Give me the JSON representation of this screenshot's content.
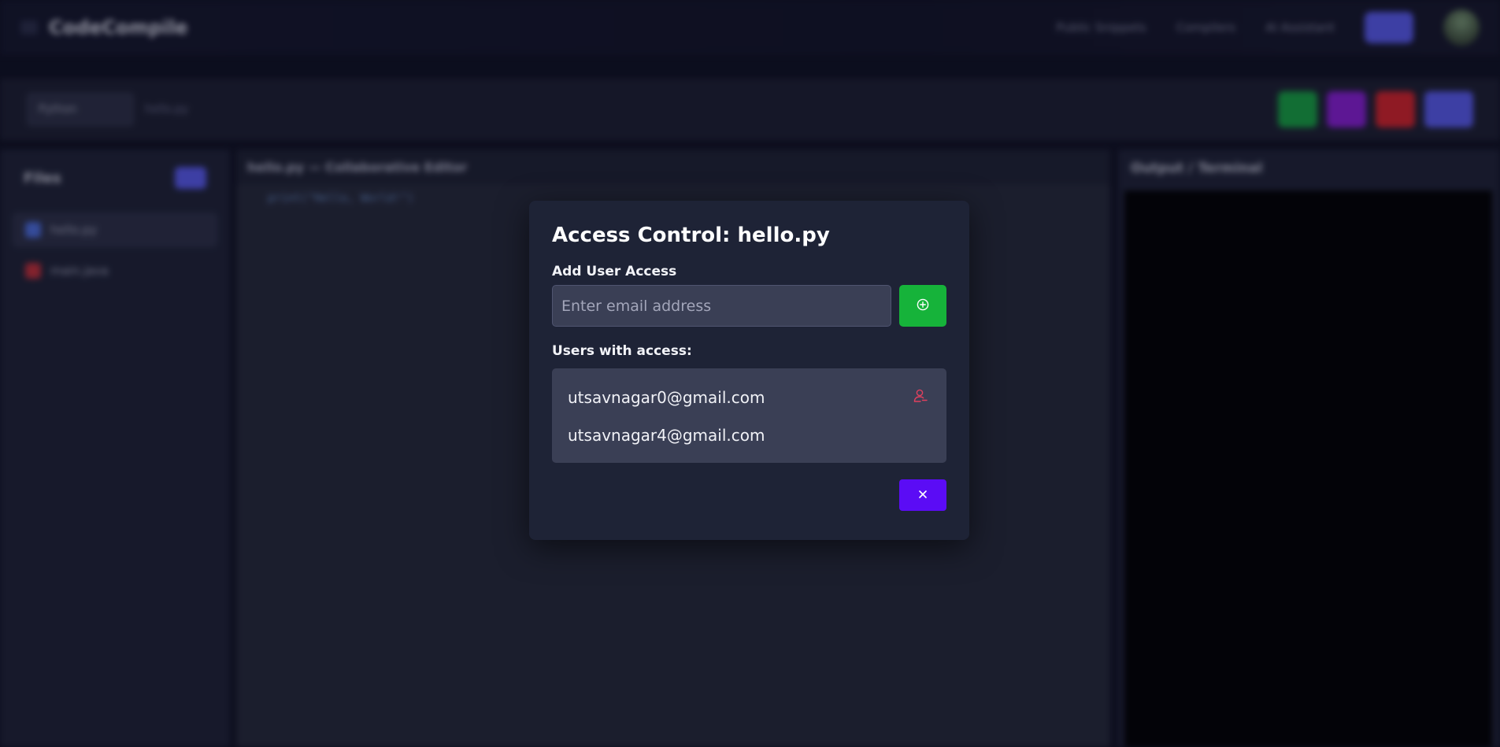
{
  "app": {
    "logo_text": "CodeCompile",
    "nav": [
      "Public Snippets",
      "Compilers",
      "AI Assistant"
    ]
  },
  "toolbar": {
    "language": "Python",
    "file_name": "hello.py"
  },
  "sidebar": {
    "title": "Files",
    "items": [
      {
        "label": "hello.py"
      },
      {
        "label": "main.java"
      }
    ]
  },
  "editor": {
    "title": "hello.py — Collaborative Editor",
    "line": "print(\"Hello, World!\")"
  },
  "output": {
    "title": "Output / Terminal"
  },
  "modal": {
    "title": "Access Control: hello.py",
    "add_label": "Add User Access",
    "email_placeholder": "Enter email address",
    "email_value": "",
    "users_label": "Users with access:",
    "users": [
      {
        "email": "utsavnagar0@gmail.com",
        "removable": true
      },
      {
        "email": "utsavnagar4@gmail.com",
        "removable": false
      }
    ]
  },
  "colors": {
    "add_button": "#16b33a",
    "close_button": "#5b0cf5",
    "remove_icon": "#e0405e",
    "modal_bg": "#1e2336",
    "field_bg": "#3a3f55"
  },
  "icons": {
    "add": "plus-circle-icon",
    "remove": "user-minus-icon",
    "close": "close-icon"
  }
}
